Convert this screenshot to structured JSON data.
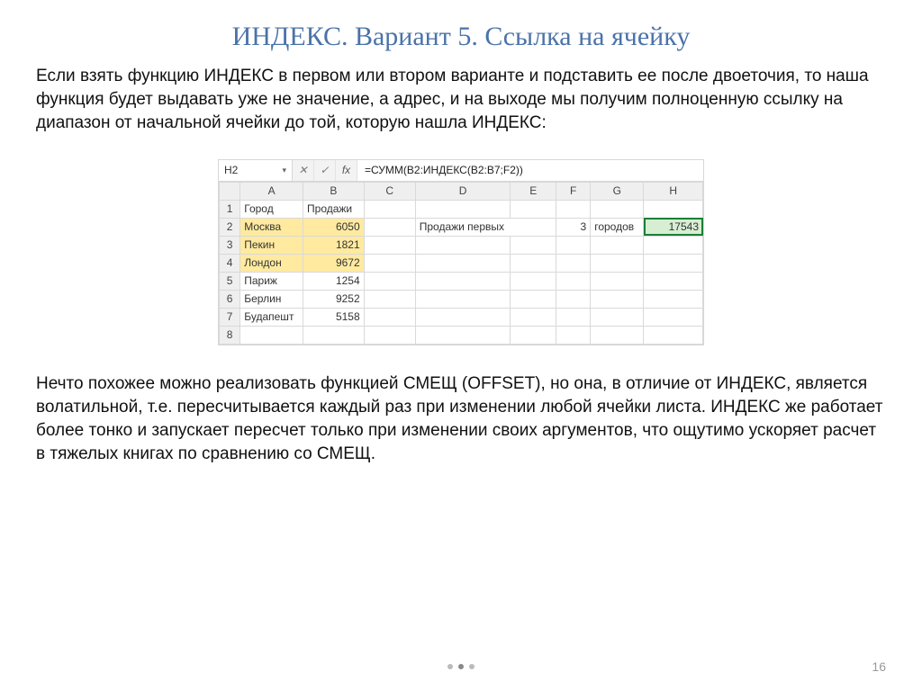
{
  "title": "ИНДЕКС. Вариант 5. Ссылка на ячейку",
  "intro": "Если взять функцию ИНДЕКС в первом или втором варианте и подставить ее после двоеточия, то наша функция будет выдавать уже не значение, а адрес, и на выходе мы получим полноценную ссылку на диапазон от начальной ячейки до той, которую нашла ИНДЕКС:",
  "outro": "Нечто похожее можно реализовать функцией СМЕЩ (OFFSET), но она, в отличие от ИНДЕКС, является волатильной, т.е. пересчитывается каждый раз при изменении любой ячейки листа. ИНДЕКС же работает более тонко и запускает пересчет только при изменении своих аргументов, что ощутимо ускоряет расчет в тяжелых книгах по сравнению со СМЕЩ.",
  "page_number": "16",
  "excel": {
    "namebox": "H2",
    "fx_cancel": "✕",
    "fx_confirm": "✓",
    "fx_label": "fx",
    "formula": "=СУММ(B2:ИНДЕКС(B2:B7;F2))",
    "columns": [
      "A",
      "B",
      "C",
      "D",
      "E",
      "F",
      "G",
      "H"
    ],
    "rows": [
      {
        "n": "1",
        "A": "Город",
        "B": "Продажи",
        "C": "",
        "D": "",
        "E": "",
        "F": "",
        "G": "",
        "H": ""
      },
      {
        "n": "2",
        "A": "Москва",
        "B": "6050",
        "C": "",
        "D": "Продажи первых",
        "E": "",
        "F": "3",
        "G": "городов",
        "H": "17543"
      },
      {
        "n": "3",
        "A": "Пекин",
        "B": "1821",
        "C": "",
        "D": "",
        "E": "",
        "F": "",
        "G": "",
        "H": ""
      },
      {
        "n": "4",
        "A": "Лондон",
        "B": "9672",
        "C": "",
        "D": "",
        "E": "",
        "F": "",
        "G": "",
        "H": ""
      },
      {
        "n": "5",
        "A": "Париж",
        "B": "1254",
        "C": "",
        "D": "",
        "E": "",
        "F": "",
        "G": "",
        "H": ""
      },
      {
        "n": "6",
        "A": "Берлин",
        "B": "9252",
        "C": "",
        "D": "",
        "E": "",
        "F": "",
        "G": "",
        "H": ""
      },
      {
        "n": "7",
        "A": "Будапешт",
        "B": "5158",
        "C": "",
        "D": "",
        "E": "",
        "F": "",
        "G": "",
        "H": ""
      },
      {
        "n": "8",
        "A": "",
        "B": "",
        "C": "",
        "D": "",
        "E": "",
        "F": "",
        "G": "",
        "H": ""
      }
    ]
  }
}
